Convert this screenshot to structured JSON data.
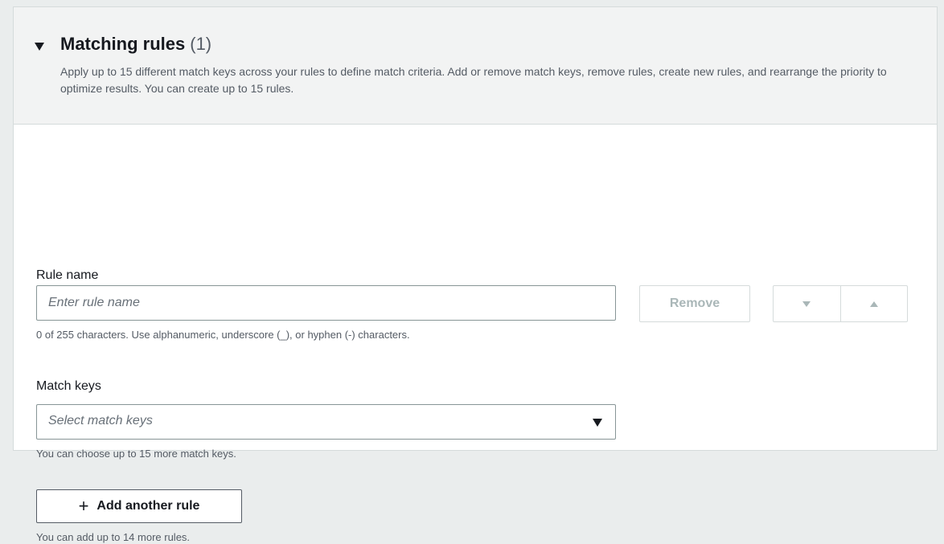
{
  "section": {
    "title": "Matching rules",
    "count": "(1)",
    "description": "Apply up to 15 different match keys across your rules to define match criteria. Add or remove match keys, remove rules, create new rules, and rearrange the priority to optimize results. You can create up to 15 rules."
  },
  "rule": {
    "name_label": "Rule name",
    "name_placeholder": "Enter rule name",
    "name_value": "",
    "name_hint": "0 of 255 characters. Use alphanumeric, underscore (_), or hyphen (-) characters.",
    "remove_label": "Remove",
    "move_down_icon": "triangle-down-icon",
    "move_up_icon": "triangle-up-icon"
  },
  "match_keys": {
    "label": "Match keys",
    "placeholder": "Select match keys",
    "hint": "You can choose up to 15 more match keys."
  },
  "add_rule": {
    "icon": "+",
    "label": "Add another rule",
    "hint": "You can add up to 14 more rules."
  },
  "colors": {
    "header_bg": "#f2f3f3",
    "border": "#d5dbdb",
    "disabled_text": "#aab7b8",
    "hint_text": "#545b64"
  }
}
